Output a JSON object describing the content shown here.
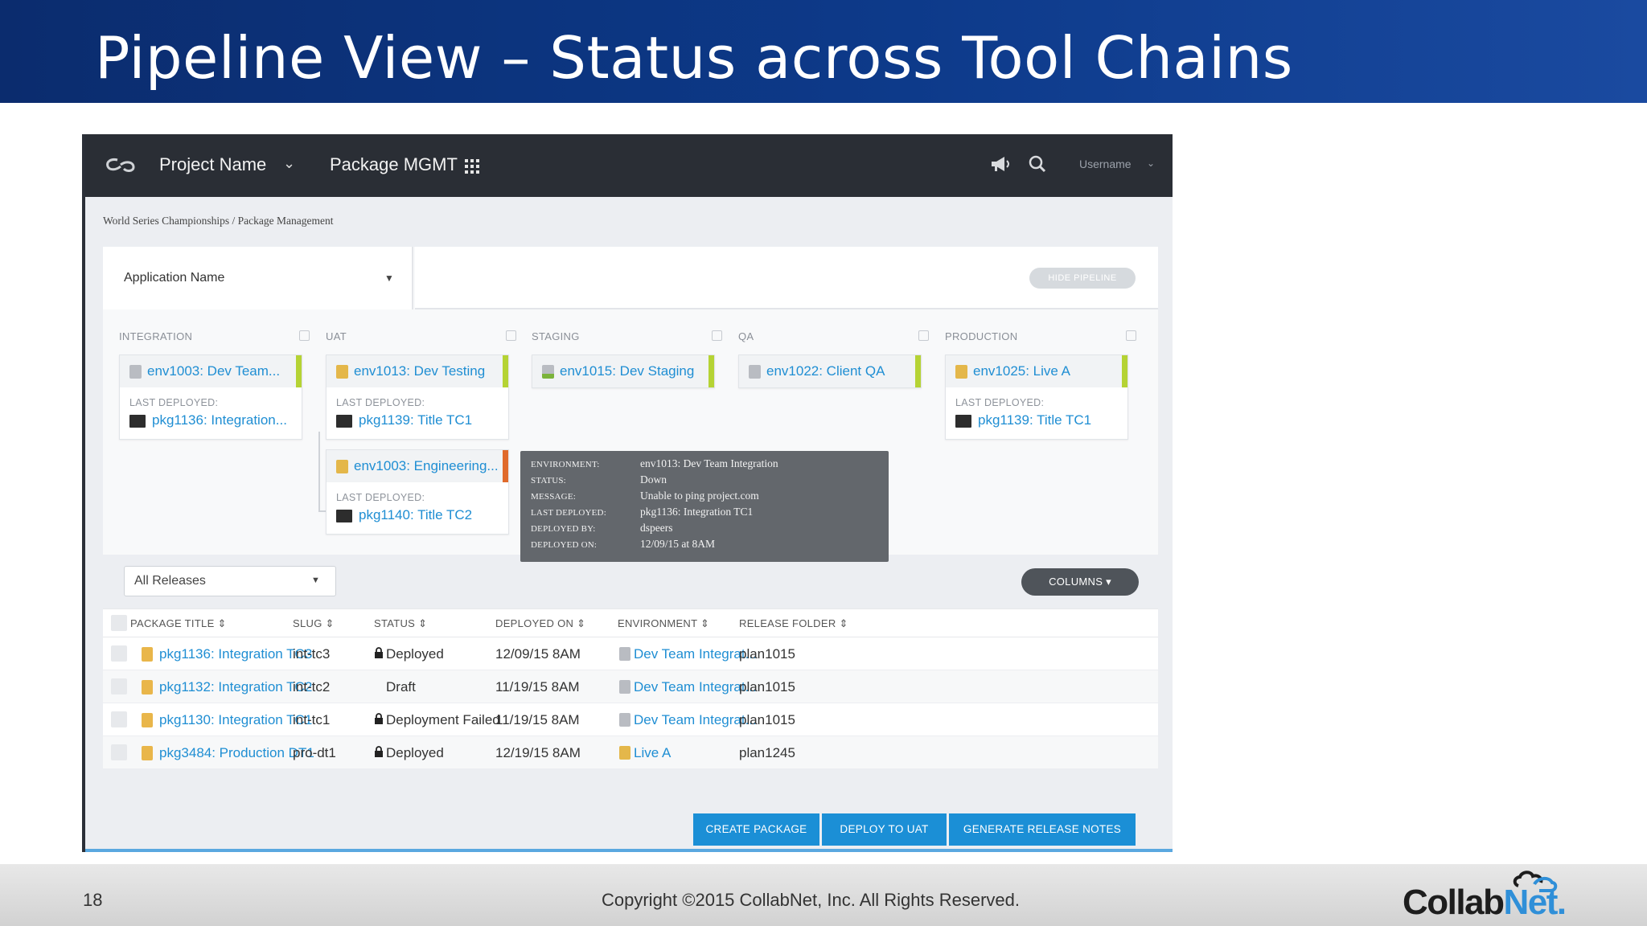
{
  "slide": {
    "title": "Pipeline View –  Status across Tool Chains",
    "page_number": "18",
    "copyright": "Copyright ©2015 CollabNet, Inc.  All Rights Reserved.",
    "brand": {
      "part1": "Collab",
      "part2": "Net",
      "suffix": "."
    },
    "colors": {
      "header_blue": "#0d3a8a",
      "link_blue": "#1f8ed3",
      "status_green": "#b5d334",
      "status_orange": "#e06a2c",
      "button_blue": "#1b8fd6"
    }
  },
  "topbar": {
    "project": "Project Name",
    "module": "Package MGMT",
    "user": "Username",
    "icons": [
      "logo-icon",
      "chevron-down-icon",
      "grid-icon",
      "megaphone-icon",
      "search-icon"
    ]
  },
  "breadcrumb": "World Series Championships / Package Management",
  "pipeline": {
    "app_select": "Application Name",
    "hide_button": "HIDE PIPELINE",
    "stages": [
      {
        "label": "INTEGRATION"
      },
      {
        "label": "UAT"
      },
      {
        "label": "STAGING"
      },
      {
        "label": "QA"
      },
      {
        "label": "PRODUCTION"
      }
    ],
    "envs": {
      "integration": {
        "name": "env1003: Dev Team...",
        "last_deployed_label": "LAST DEPLOYED:",
        "package": "pkg1136: Integration..."
      },
      "uat": {
        "name": "env1013: Dev Testing",
        "last_deployed_label": "LAST DEPLOYED:",
        "package": "pkg1139: Title TC1"
      },
      "uat2": {
        "name": "env1003: Engineering...",
        "last_deployed_label": "LAST DEPLOYED:",
        "package": "pkg1140: Title TC2"
      },
      "staging": {
        "name": "env1015: Dev Staging"
      },
      "qa": {
        "name": "env1022: Client QA"
      },
      "production": {
        "name": "env1025: Live A",
        "last_deployed_label": "LAST DEPLOYED:",
        "package": "pkg1139: Title TC1"
      }
    },
    "tooltip": {
      "environment_label": "ENVIRONMENT:",
      "environment": "env1013: Dev Team Integration",
      "status_label": "STATUS:",
      "status": "Down",
      "message_label": "MESSAGE:",
      "message": "Unable to ping project.com",
      "last_deployed_label": "LAST DEPLOYED:",
      "last_deployed": "pkg1136: Integration TC1",
      "deployed_by_label": "DEPLOYED BY:",
      "deployed_by": "dspeers",
      "deployed_on_label": "DEPLOYED ON:",
      "deployed_on": "12/09/15 at 8AM"
    }
  },
  "releases_filter": "All Releases",
  "columns_button": "COLUMNS",
  "table": {
    "headers": {
      "package_title": "PACKAGE TITLE",
      "slug": "SLUG",
      "status": "STATUS",
      "deployed_on": "DEPLOYED ON",
      "environment": "ENVIRONMENT",
      "release_folder": "RELEASE FOLDER"
    },
    "rows": [
      {
        "title": "pkg1136: Integration TC3",
        "slug": "int-tc3",
        "status": "Deployed",
        "locked": true,
        "deployed_on": "12/09/15 8AM",
        "environment": "Dev Team Integrat...",
        "folder": "plan1015"
      },
      {
        "title": "pkg1132: Integration TC2",
        "slug": "int-tc2",
        "status": "Draft",
        "locked": false,
        "deployed_on": "11/19/15 8AM",
        "environment": "Dev Team Integrat...",
        "folder": "plan1015"
      },
      {
        "title": "pkg1130: Integration TC1",
        "slug": "int-tc1",
        "status": "Deployment Failed",
        "locked": true,
        "deployed_on": "11/19/15 8AM",
        "environment": "Dev Team Integrat...",
        "folder": "plan1015"
      },
      {
        "title": "pkg3484: Production DT1",
        "slug": "pro-dt1",
        "status": "Deployed",
        "locked": true,
        "deployed_on": "12/19/15 8AM",
        "environment": "Live A",
        "folder": "plan1245"
      }
    ]
  },
  "actions": {
    "create": "CREATE PACKAGE",
    "deploy": "DEPLOY TO UAT",
    "notes": "GENERATE RELEASE NOTES"
  }
}
